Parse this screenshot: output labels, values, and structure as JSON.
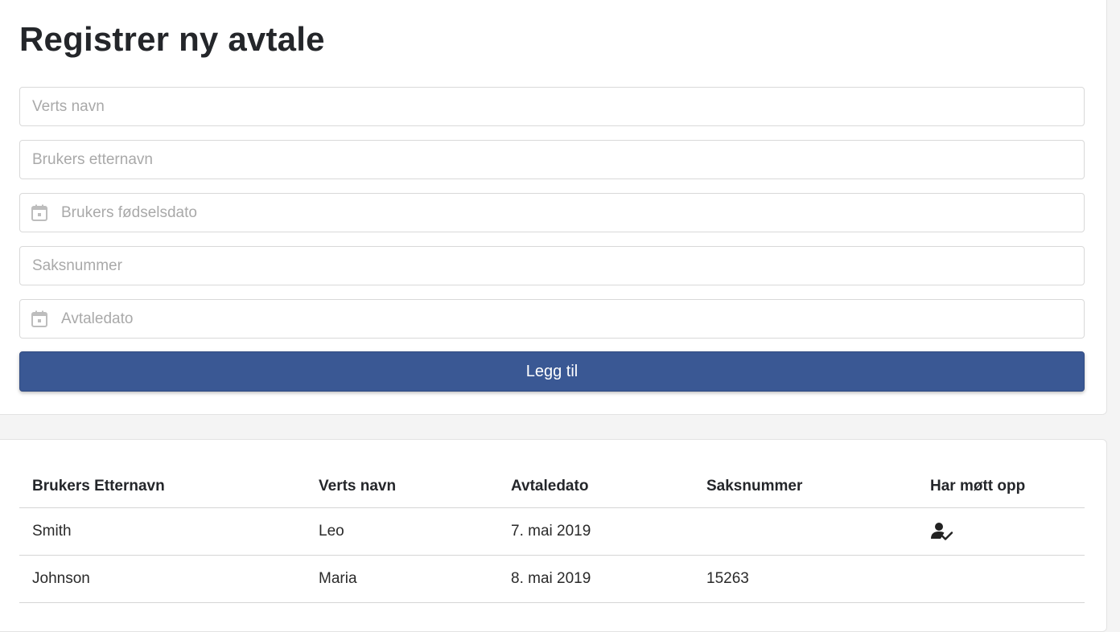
{
  "form": {
    "title": "Registrer ny avtale",
    "fields": [
      {
        "placeholder": "Verts navn",
        "icon": null
      },
      {
        "placeholder": "Brukers etternavn",
        "icon": null
      },
      {
        "placeholder": "Brukers fødselsdato",
        "icon": "calendar-icon"
      },
      {
        "placeholder": "Saksnummer",
        "icon": null
      },
      {
        "placeholder": "Avtaledato",
        "icon": "calendar-icon"
      }
    ],
    "submit_label": "Legg til",
    "accent_color": "#3a5894"
  },
  "table": {
    "headers": [
      "Brukers Etternavn",
      "Verts navn",
      "Avtaledato",
      "Saksnummer",
      "Har møtt opp"
    ],
    "rows": [
      {
        "etternavn": "Smith",
        "vert": "Leo",
        "dato": "7. mai 2019",
        "saksnummer": "",
        "har_mott_opp": true,
        "attend_icon": "person-check-icon"
      },
      {
        "etternavn": "Johnson",
        "vert": "Maria",
        "dato": "8. mai 2019",
        "saksnummer": "15263",
        "har_mott_opp": false,
        "attend_icon": null
      }
    ]
  }
}
